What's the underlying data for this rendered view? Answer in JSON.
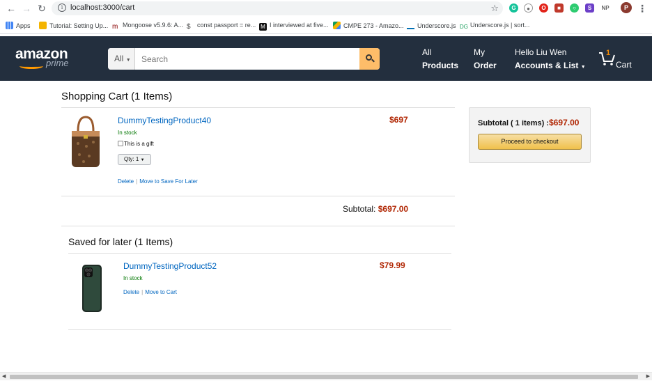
{
  "browser": {
    "url": "localhost:3000/cart",
    "bookmarks": [
      "Apps",
      "Tutorial: Setting Up...",
      "Mongoose v5.9.6: A...",
      "const passport = re...",
      "I interviewed at five...",
      "CMPE 273 - Amazo...",
      "Underscore.js",
      "Underscore.js | sort..."
    ],
    "profile_initial": "P",
    "ext_np": "NP"
  },
  "header": {
    "logo_main": "amazon",
    "logo_sub": "prime",
    "search_category": "All",
    "search_placeholder": "Search",
    "nav": [
      {
        "line1": "All",
        "line2": "Products"
      },
      {
        "line1": "My",
        "line2": "Order"
      },
      {
        "line1": "Hello Liu Wen",
        "line2": "Accounts & List"
      }
    ],
    "cart_count": "1",
    "cart_label": "Cart"
  },
  "cart": {
    "heading": "Shopping Cart (1 Items)",
    "items": [
      {
        "title": "DummyTestingProduct40",
        "stock": "In stock",
        "gift_label": "This is a gift",
        "qty_label": "Qty: 1",
        "price": "$697",
        "delete_label": "Delete",
        "save_label": "Move to Save For Later"
      }
    ],
    "subtotal_label": "Subtotal:",
    "subtotal_amount": "$697.00"
  },
  "sidebar": {
    "subtotal_label": "Subtotal ( 1 items) :",
    "subtotal_amount": "$697.00",
    "checkout_label": "Proceed to checkout"
  },
  "saved": {
    "heading": "Saved for later (1 Items)",
    "items": [
      {
        "title": "DummyTestingProduct52",
        "stock": "In stock",
        "price": "$79.99",
        "delete_label": "Delete",
        "move_label": "Move to Cart"
      }
    ]
  },
  "colors": {
    "header_bg": "#232f3e",
    "accent": "#febd69",
    "price": "#b12704",
    "link": "#0066c0",
    "stock": "#007600"
  }
}
